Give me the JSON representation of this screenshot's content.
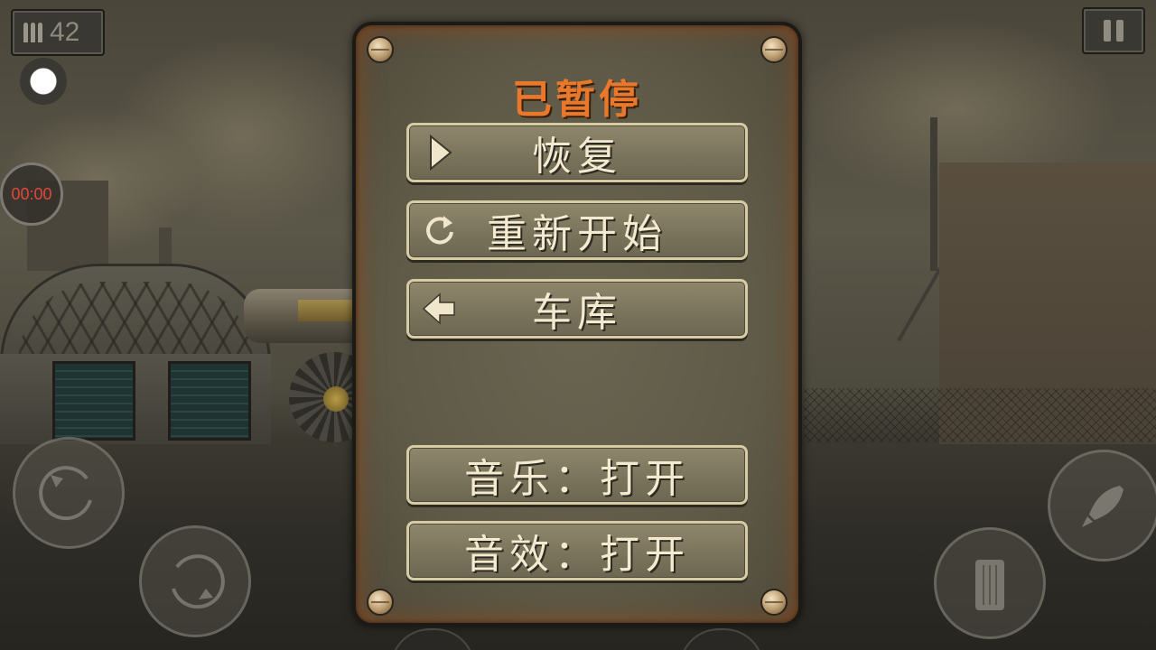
{
  "hud": {
    "ammo_count": "42",
    "timer": "00:00",
    "ammo_icon": "bullets-icon",
    "pause_icon": "pause-icon",
    "record_icon": "record-dot-icon"
  },
  "pause_menu": {
    "title": "已暂停",
    "buttons": [
      {
        "label": "恢复",
        "icon": "play-icon"
      },
      {
        "label": "重新开始",
        "icon": "restart-icon"
      },
      {
        "label": "车库",
        "icon": "back-arrow-icon"
      },
      {
        "label": "音乐：打开",
        "icon": null
      },
      {
        "label": "音效：打开",
        "icon": null
      }
    ]
  },
  "controls": {
    "left_rotate_icon": "rotate-counterclockwise-icon",
    "right_rotate_icon": "rotate-clockwise-icon",
    "rocket_icon": "rocket-icon",
    "trash_icon": "trash-icon"
  },
  "colors": {
    "title": "#e8782c",
    "button_text": "#f3ead0",
    "timer_text": "#e2473a"
  }
}
